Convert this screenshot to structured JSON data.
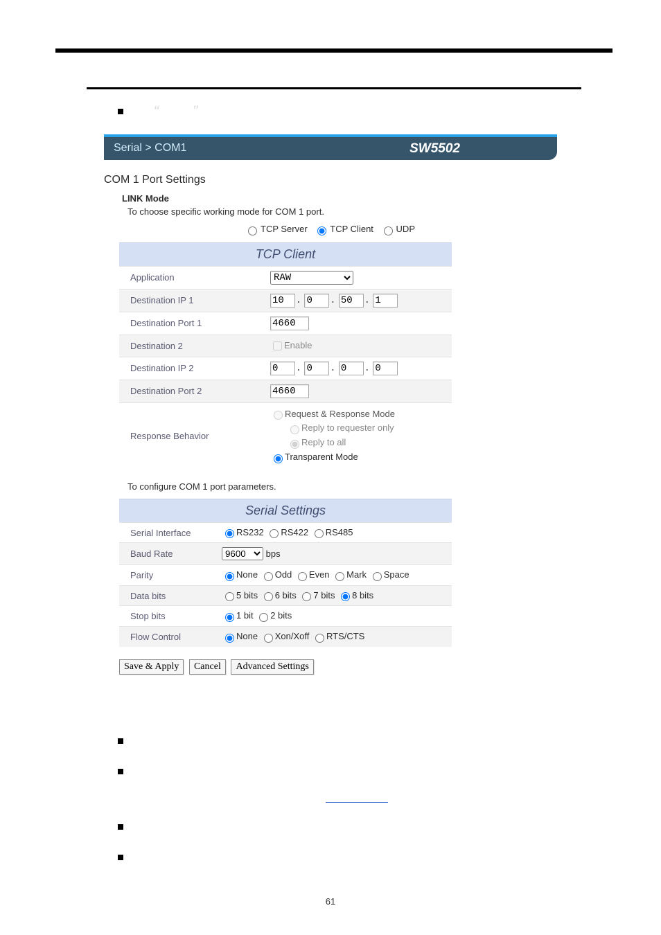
{
  "header": {
    "breadcrumb": "Serial > COM1",
    "model": "SW5502"
  },
  "port_settings_title": "COM 1 Port Settings",
  "link_mode": {
    "heading": "LINK Mode",
    "note": "To choose specific working mode for COM 1 port.",
    "modes": [
      "TCP Server",
      "TCP Client",
      "UDP"
    ],
    "selected": "TCP Client"
  },
  "tcp_client": {
    "title": "TCP Client",
    "application_label": "Application",
    "application_value": "RAW",
    "dest_ip1_label": "Destination IP 1",
    "dest_ip1": [
      "10",
      "0",
      "50",
      "1"
    ],
    "dest_port1_label": "Destination Port 1",
    "dest_port1": "4660",
    "dest2_label": "Destination 2",
    "dest2_enable_text": "Enable",
    "dest2_enabled": false,
    "dest_ip2_label": "Destination IP 2",
    "dest_ip2": [
      "0",
      "0",
      "0",
      "0"
    ],
    "dest_port2_label": "Destination Port 2",
    "dest_port2": "4660",
    "resp_label": "Response Behavior",
    "resp_option1": "Request & Response Mode",
    "resp_sub1": "Reply to requester only",
    "resp_sub2": "Reply to all",
    "resp_option2": "Transparent Mode"
  },
  "serial_note": "To configure COM 1 port parameters.",
  "serial": {
    "title": "Serial Settings",
    "iface_label": "Serial Interface",
    "iface_options": [
      "RS232",
      "RS422",
      "RS485"
    ],
    "baud_label": "Baud Rate",
    "baud_value": "9600",
    "baud_unit": "bps",
    "parity_label": "Parity",
    "parity_options": [
      "None",
      "Odd",
      "Even",
      "Mark",
      "Space"
    ],
    "data_label": "Data bits",
    "data_options": [
      "5 bits",
      "6 bits",
      "7 bits",
      "8 bits"
    ],
    "stop_label": "Stop bits",
    "stop_options": [
      "1 bit",
      "2 bits"
    ],
    "flow_label": "Flow Control",
    "flow_options": [
      "None",
      "Xon/Xoff",
      "RTS/CTS"
    ]
  },
  "buttons": {
    "save": "Save & Apply",
    "cancel": "Cancel",
    "advanced": "Advanced Settings"
  },
  "page_number": "61"
}
